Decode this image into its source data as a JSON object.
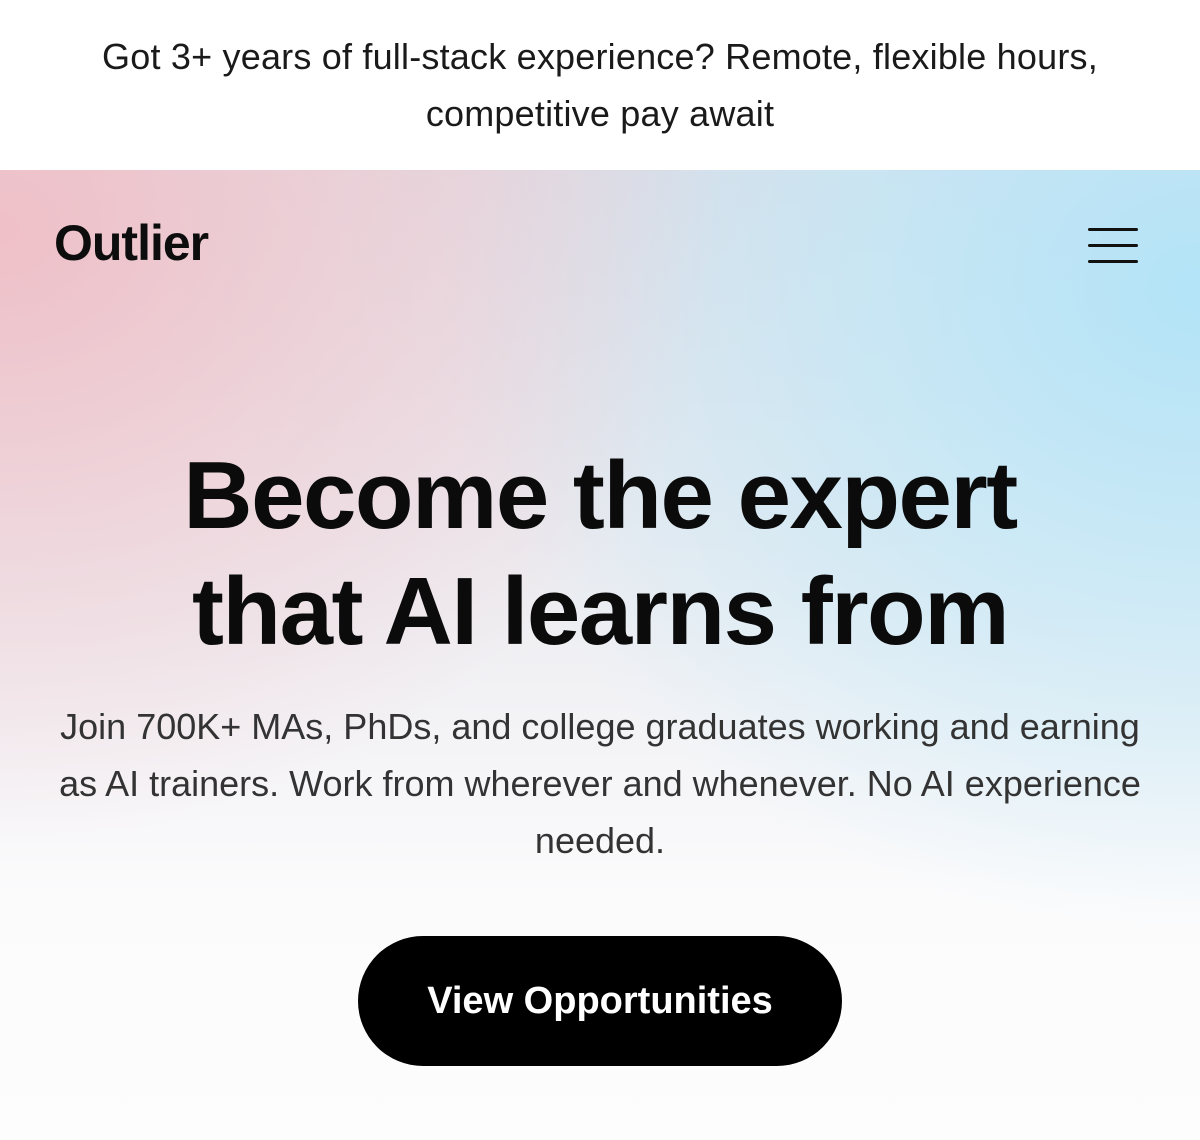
{
  "banner": {
    "text": "Got 3+ years of full-stack experience? Remote, flexible hours, competitive pay await"
  },
  "header": {
    "logo_text": "Outlier",
    "menu_icon": "hamburger-menu-icon"
  },
  "hero": {
    "headline_line1": "Become the expert",
    "headline_line2": "that AI learns from",
    "subtext": "Join 700K+ MAs, PhDs, and college graduates working and earning as AI trainers. Work from wherever and whenever. No AI experience needed.",
    "cta_label": "View Opportunities"
  },
  "colors": {
    "cta_background": "#000000",
    "cta_text": "#ffffff",
    "gradient_left": "#f0bec6",
    "gradient_right": "#b2e4f8"
  }
}
